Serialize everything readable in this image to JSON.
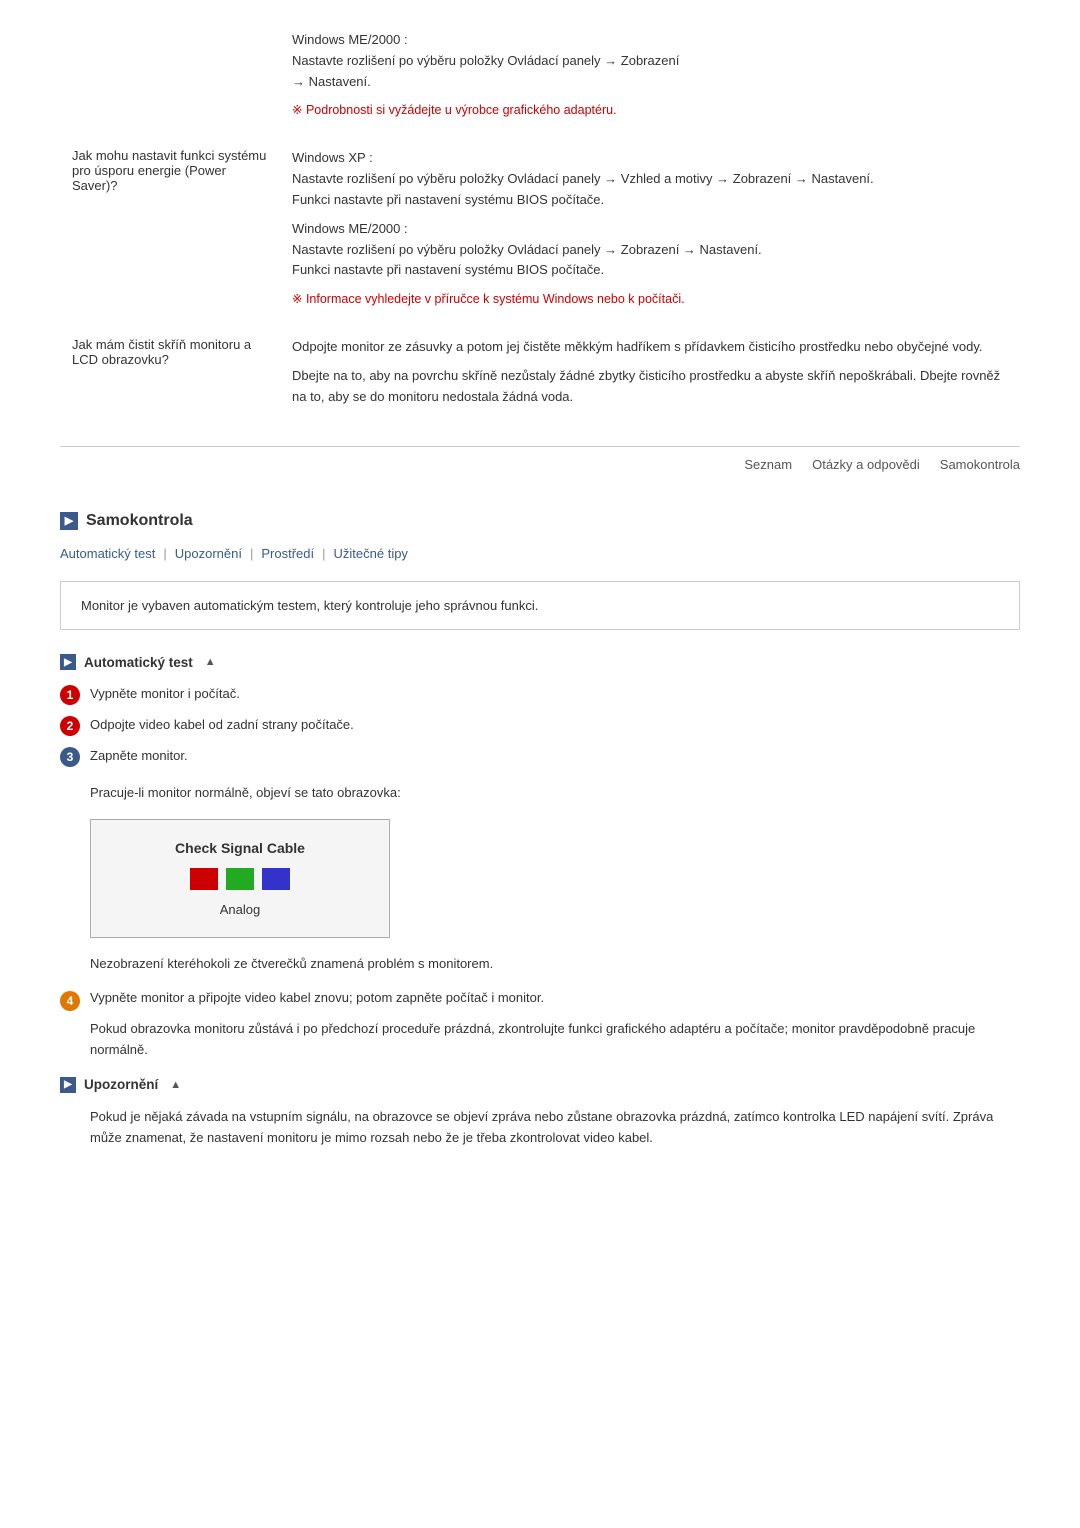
{
  "faq": {
    "rows": [
      {
        "question": "Jak mohu nastavit funkci systému pro úsporu energie (Power Saver)?",
        "answers": [
          {
            "type": "text",
            "content": "Windows XP :\nNastavte rozlišení po výběru položky Ovládací panely → Vzhled a motivy → Zobrazení → Nastavení.\nFunkci nastavte při nastavení systému BIOS počítače."
          },
          {
            "type": "text",
            "content": "Windows ME/2000 :\nNastavte rozlišení po výběru položky Ovládací panely → Zobrazení → Nastavení.\nFunkci nastavte při nastavení systému BIOS počítače."
          },
          {
            "type": "link",
            "content": "Informace vyhledejte v příručce k systému Windows nebo k počítači."
          }
        ]
      },
      {
        "question": "Jak mám čistit skříň monitoru a LCD obrazovku?",
        "answers": [
          {
            "type": "text",
            "content": "Odpojte monitor ze zásuvky a potom jej čistěte měkkým hadříkem s přídavkem čisticího prostředku nebo obyčejné vody."
          },
          {
            "type": "text",
            "content": "Dbejte na to, aby na povrchu skříně nezůstaly žádné zbytky čisticího prostředku a abyste skříň nepoškrábali. Dbejte rovněž na to, aby se do monitoru nedostala žádná voda."
          }
        ]
      }
    ],
    "top_rows": [
      {
        "question": "",
        "answers": [
          {
            "type": "text",
            "content": "Windows ME/2000 :\nNastavte rozlišení po výběru položky Ovládací panely → Zobrazení\n→ Nastavení."
          },
          {
            "type": "link",
            "content": "Podrobnosti si vyžádejte u výrobce grafického adaptéru."
          }
        ]
      }
    ]
  },
  "bottom_nav": {
    "items": [
      "Seznam",
      "Otázky a odpovědi",
      "Samokontrola"
    ]
  },
  "samokontrola": {
    "section_title": "Samokontrola",
    "tabs": [
      "Automatický test",
      "Upozornění",
      "Prostředí",
      "Užitečné tipy"
    ],
    "tab_separators": [
      "|",
      "|",
      "|"
    ],
    "info_box": "Monitor je vybaven automatickým testem, který kontroluje jeho správnou funkci.",
    "auto_test": {
      "title": "Automatický test",
      "steps": [
        {
          "num": 1,
          "color": "red",
          "text": "Vypněte monitor i počítač."
        },
        {
          "num": 2,
          "color": "red",
          "text": "Odpojte video kabel od zadní strany počítače."
        },
        {
          "num": 3,
          "color": "blue",
          "text": "Zapněte monitor."
        }
      ],
      "step3_sub": "Pracuje-li monitor normálně, objeví se tato obrazovka:",
      "signal_box": {
        "title": "Check Signal Cable",
        "colors": [
          "#cc0000",
          "#22aa22",
          "#3333cc"
        ],
        "label": "Analog"
      },
      "note_after_box": "Nezobrazení kteréhokoli ze čtverečků znamená problém s monitorem.",
      "step4": {
        "num": 4,
        "color": "orange",
        "text": "Vypněte monitor a připojte video kabel znovu; potom zapněte počítač i monitor.",
        "sub": "Pokud obrazovka monitoru zůstává i po předchozí proceduře prázdná, zkontrolujte funkci grafického adaptéru a počítače; monitor pravděpodobně pracuje normálně."
      }
    },
    "upozorneni": {
      "title": "Upozornění",
      "text": "Pokud je nějaká závada na vstupním signálu, na obrazovce se objeví zpráva nebo zůstane obrazovka prázdná, zatímco kontrolka LED napájení svítí. Zpráva může znamenat, že nastavení monitoru je mimo rozsah nebo že je třeba zkontrolovat video kabel."
    }
  }
}
